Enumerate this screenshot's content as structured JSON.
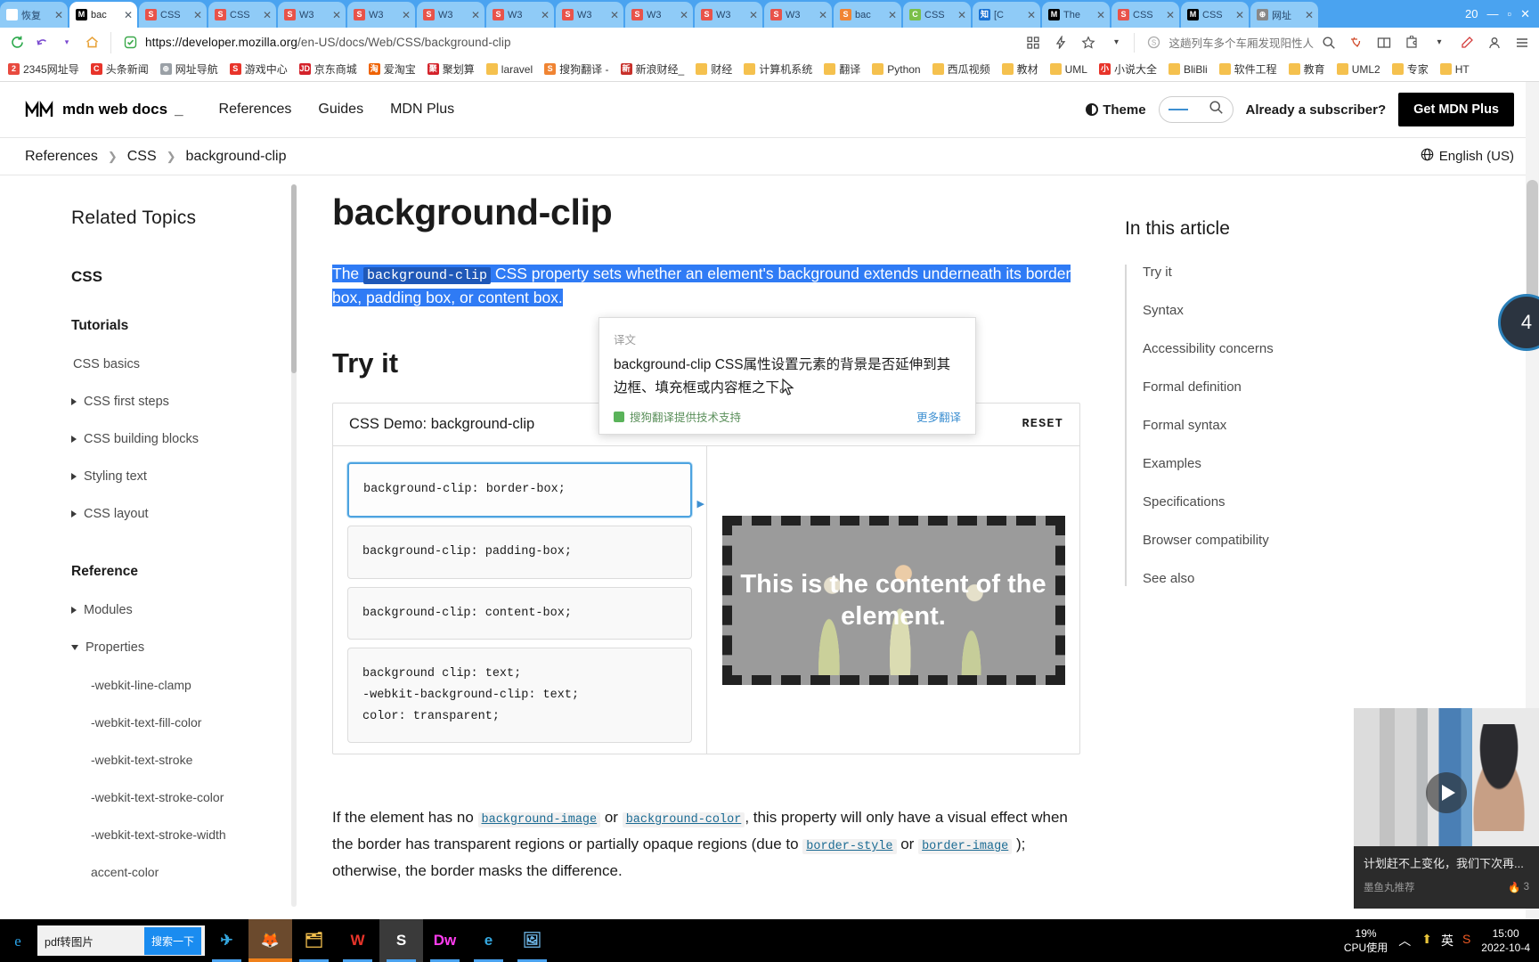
{
  "browser": {
    "tabs": [
      {
        "label": "恢复",
        "icon": "restore-icon",
        "icon_color": "#ffffff",
        "icon_text": "恢",
        "active": false
      },
      {
        "label": "bac",
        "icon": "mdn-icon",
        "icon_color": "#000000",
        "icon_text": "M",
        "active": true
      },
      {
        "label": "CSS",
        "icon": "w3c-icon",
        "icon_color": "#e8534a",
        "icon_text": "S",
        "active": false
      },
      {
        "label": "CSS",
        "icon": "w3c-icon",
        "icon_color": "#e8534a",
        "icon_text": "S",
        "active": false
      },
      {
        "label": "W3",
        "icon": "w3c-icon",
        "icon_color": "#e8534a",
        "icon_text": "S",
        "active": false
      },
      {
        "label": "W3",
        "icon": "w3c-icon",
        "icon_color": "#e8534a",
        "icon_text": "S",
        "active": false
      },
      {
        "label": "W3",
        "icon": "w3c-icon",
        "icon_color": "#e8534a",
        "icon_text": "S",
        "active": false
      },
      {
        "label": "W3",
        "icon": "w3c-icon",
        "icon_color": "#e8534a",
        "icon_text": "S",
        "active": false
      },
      {
        "label": "W3",
        "icon": "w3c-icon",
        "icon_color": "#e8534a",
        "icon_text": "S",
        "active": false
      },
      {
        "label": "W3",
        "icon": "w3c-icon",
        "icon_color": "#e8534a",
        "icon_text": "S",
        "active": false
      },
      {
        "label": "W3",
        "icon": "w3c-icon",
        "icon_color": "#e8534a",
        "icon_text": "S",
        "active": false
      },
      {
        "label": "W3",
        "icon": "w3c-icon",
        "icon_color": "#e8534a",
        "icon_text": "S",
        "active": false
      },
      {
        "label": "bac",
        "icon": "sogou-icon",
        "icon_color": "#f08433",
        "icon_text": "S",
        "active": false
      },
      {
        "label": "CSS",
        "icon": "green-icon",
        "icon_color": "#7bbf4a",
        "icon_text": "C",
        "active": false
      },
      {
        "label": "[C",
        "icon": "zhihu-icon",
        "icon_color": "#1a72d4",
        "icon_text": "知",
        "active": false
      },
      {
        "label": "The",
        "icon": "mdn-icon",
        "icon_color": "#000000",
        "icon_text": "M",
        "active": false
      },
      {
        "label": "CSS",
        "icon": "w3c-icon",
        "icon_color": "#e8534a",
        "icon_text": "S",
        "active": false
      },
      {
        "label": "CSS",
        "icon": "mdn-icon",
        "icon_color": "#000000",
        "icon_text": "M",
        "active": false
      },
      {
        "label": "网址",
        "icon": "globe-icon",
        "icon_color": "#888888",
        "icon_text": "⊕",
        "active": false
      }
    ],
    "window_controls": {
      "count_badge": "20",
      "minimize": "—",
      "maximize": "▫",
      "close": "✕"
    },
    "url_host": "https://developer.mozilla.org",
    "url_path": "/en-US/docs/Web/CSS/background-clip",
    "omnibox_query": "这趟列车多个车厢发现阳性人",
    "icons": {
      "reload": "reload-icon",
      "back": "back-icon",
      "home": "home-icon",
      "shield": "shield-icon",
      "apps": "apps-grid-icon",
      "lightning": "lightning-icon",
      "star": "star-icon",
      "dropdown": "chevron-down-icon",
      "search": "search-icon",
      "translate": "translate-icon",
      "split": "split-screen-icon",
      "puzzle": "extension-icon",
      "pen": "pen-icon",
      "user": "user-icon",
      "menu": "menu-icon"
    },
    "bookmarks": [
      {
        "label": "2345网址导",
        "color": "#e84a3f",
        "glyph": "2"
      },
      {
        "label": "头条新闻",
        "color": "#e8342a",
        "glyph": "C"
      },
      {
        "label": "网址导航",
        "color": "#9aa0a6",
        "glyph": "⊕"
      },
      {
        "label": "游戏中心",
        "color": "#e8342a",
        "glyph": "S"
      },
      {
        "label": "京东商城",
        "color": "#d4222a",
        "glyph": "JD"
      },
      {
        "label": "爱淘宝",
        "color": "#ef6200",
        "glyph": "淘"
      },
      {
        "label": "聚划算",
        "color": "#d4222a",
        "glyph": "聚"
      },
      {
        "label": "laravel",
        "color": "#f5c14e",
        "glyph": ""
      },
      {
        "label": "搜狗翻译 -",
        "color": "#f08433",
        "glyph": "S"
      },
      {
        "label": "新浪财经_",
        "color": "#c8302a",
        "glyph": "新"
      },
      {
        "label": "财经",
        "color": "#f5c14e",
        "glyph": ""
      },
      {
        "label": "计算机系统",
        "color": "#f5c14e",
        "glyph": ""
      },
      {
        "label": "翻译",
        "color": "#f5c14e",
        "glyph": ""
      },
      {
        "label": "Python",
        "color": "#f5c14e",
        "glyph": ""
      },
      {
        "label": "西瓜视频",
        "color": "#f5c14e",
        "glyph": ""
      },
      {
        "label": "教材",
        "color": "#f5c14e",
        "glyph": ""
      },
      {
        "label": "UML",
        "color": "#f5c14e",
        "glyph": ""
      },
      {
        "label": "小说大全",
        "color": "#e8342a",
        "glyph": "小"
      },
      {
        "label": "BliBli",
        "color": "#f5c14e",
        "glyph": ""
      },
      {
        "label": "软件工程",
        "color": "#f5c14e",
        "glyph": ""
      },
      {
        "label": "教育",
        "color": "#f5c14e",
        "glyph": ""
      },
      {
        "label": "UML2",
        "color": "#f5c14e",
        "glyph": ""
      },
      {
        "label": "专家",
        "color": "#f5c14e",
        "glyph": ""
      },
      {
        "label": "HT",
        "color": "#f5c14e",
        "glyph": ""
      }
    ]
  },
  "mdn": {
    "logo_text": "mdn web docs",
    "nav": [
      "References",
      "Guides",
      "MDN Plus"
    ],
    "theme_label": "Theme",
    "already_subscriber": "Already a subscriber?",
    "get_mdn_plus": "Get MDN Plus",
    "language": "English (US)",
    "breadcrumb": [
      "References",
      "CSS",
      "background-clip"
    ],
    "breadcrumb_sep": "❯"
  },
  "sidebar": {
    "title": "Related Topics",
    "section_css": "CSS",
    "tutorials_heading": "Tutorials",
    "tutorials": [
      {
        "label": "CSS basics",
        "expandable": false
      },
      {
        "label": "CSS first steps",
        "expandable": true
      },
      {
        "label": "CSS building blocks",
        "expandable": true
      },
      {
        "label": "Styling text",
        "expandable": true
      },
      {
        "label": "CSS layout",
        "expandable": true
      }
    ],
    "reference_heading": "Reference",
    "reference": [
      {
        "label": "Modules",
        "state": "collapsed"
      },
      {
        "label": "Properties",
        "state": "expanded"
      }
    ],
    "properties": [
      "-webkit-line-clamp",
      "-webkit-text-fill-color",
      "-webkit-text-stroke",
      "-webkit-text-stroke-color",
      "-webkit-text-stroke-width",
      "accent-color"
    ]
  },
  "article": {
    "title": "background-clip",
    "intro": {
      "part1": "The ",
      "code1": "background-clip",
      "part2": " CSS property sets whether an element's background extends underneath its border box, padding box, or content box."
    },
    "tryit_heading": "Try it",
    "demo": {
      "title": "CSS Demo: background-clip",
      "reset_label": "RESET",
      "choices": [
        {
          "lines": [
            "background-clip: border-box;"
          ],
          "selected": true
        },
        {
          "lines": [
            "background-clip: padding-box;"
          ],
          "selected": false
        },
        {
          "lines": [
            "background-clip: content-box;"
          ],
          "selected": false
        },
        {
          "lines": [
            "background clip: text;",
            "-webkit-background-clip: text;",
            "color: transparent;"
          ],
          "selected": false
        }
      ],
      "preview_text": "This is the content of the element."
    },
    "after_paragraph": {
      "t1": "If the element has no ",
      "l1": "background-image",
      "t2": " or ",
      "l2": "background-color",
      "t3": ", this property will only have a visual effect when the border has transparent regions or partially opaque regions (due to ",
      "l3": "border-style",
      "t4": " or ",
      "l4": "border-image",
      "t5": " ); otherwise, the border masks the difference."
    }
  },
  "toc": {
    "title": "In this article",
    "items": [
      "Try it",
      "Syntax",
      "Accessibility concerns",
      "Formal definition",
      "Formal syntax",
      "Examples",
      "Specifications",
      "Browser compatibility",
      "See also"
    ]
  },
  "translate_popup": {
    "label": "译文",
    "text": "background-clip CSS属性设置元素的背景是否延伸到其边框、填充框或内容框之下。",
    "credit": "搜狗翻译提供技术支持",
    "more": "更多翻译"
  },
  "float_badge": {
    "value": "4"
  },
  "video_card": {
    "title": "计划赶不上变化，我们下次再...",
    "author": "墨鱼丸推荐",
    "hot": "3",
    "play_icon": "play-icon"
  },
  "taskbar": {
    "search_value": "pdf转图片",
    "search_button": "搜索一下",
    "apps": [
      {
        "name": "telegram",
        "glyph": "✈",
        "color": "#35a8e0",
        "bg": "#000000"
      },
      {
        "name": "firefox",
        "glyph": "🦊",
        "color": "#f0811a",
        "bg": "#6b4a2d"
      },
      {
        "name": "file-explorer",
        "glyph": "🗂",
        "color": "#f5c14e",
        "bg": "#000000"
      },
      {
        "name": "wps",
        "glyph": "W",
        "color": "#e8342a",
        "bg": "#000000"
      },
      {
        "name": "sogou",
        "glyph": "S",
        "color": "#ffffff",
        "bg": "#3a3a3a"
      },
      {
        "name": "dreamweaver",
        "glyph": "Dw",
        "color": "#ff3df0",
        "bg": "#000000"
      },
      {
        "name": "internet-explorer",
        "glyph": "e",
        "color": "#35a8e0",
        "bg": "#000000"
      },
      {
        "name": "photos",
        "glyph": "🖼",
        "color": "#6fb7e8",
        "bg": "#000000"
      }
    ],
    "cpu_percent": "19%",
    "cpu_label": "CPU使用",
    "chevron": "︿",
    "tray_icons": [
      {
        "name": "update-icon",
        "glyph": "⬆",
        "color": "#e8c43a"
      },
      {
        "name": "ime-icon",
        "glyph": "英",
        "color": "#ffffff"
      },
      {
        "name": "sogou-pinyin-icon",
        "glyph": "S",
        "color": "#ef5a24"
      }
    ],
    "time": "15:00",
    "date": "2022-10-4"
  }
}
